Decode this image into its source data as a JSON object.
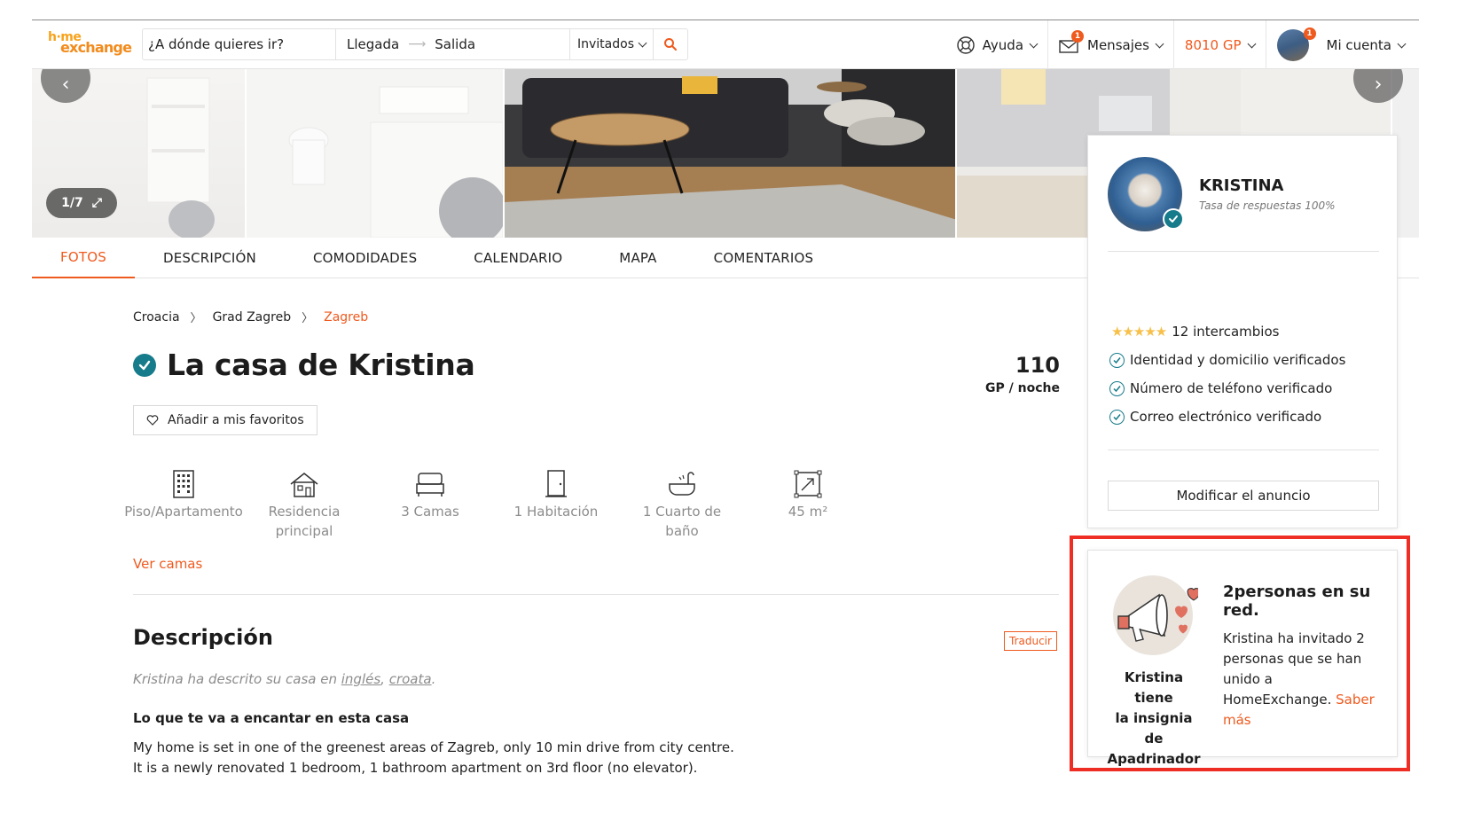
{
  "header": {
    "logo_line1": "h·me",
    "logo_line2": "exchange",
    "search_placeholder": "¿A dónde quieres ir?",
    "checkin": "Llegada",
    "checkout": "Salida",
    "guests": "Invitados",
    "help": "Ayuda",
    "messages": "Mensajes",
    "messages_badge": "1",
    "gp_balance": "8010 GP",
    "account": "Mi cuenta",
    "account_badge": "1"
  },
  "gallery": {
    "counter": "1/7"
  },
  "tabs": [
    {
      "label": "FOTOS"
    },
    {
      "label": "DESCRIPCIÓN"
    },
    {
      "label": "COMODIDADES"
    },
    {
      "label": "CALENDARIO"
    },
    {
      "label": "MAPA"
    },
    {
      "label": "COMENTARIOS"
    }
  ],
  "breadcrumb": [
    "Croacia",
    "Grad Zagreb",
    "Zagreb"
  ],
  "listing": {
    "title": "La casa de Kristina",
    "price": "110",
    "price_unit": "GP / noche",
    "favorite": "Añadir a mis favoritos",
    "features": [
      {
        "icon": "building-icon",
        "line1": "Piso/Apartamento",
        "line2": ""
      },
      {
        "icon": "house-icon",
        "line1": "Residencia",
        "line2": "principal"
      },
      {
        "icon": "bed-icon",
        "line1": "3 Camas",
        "line2": ""
      },
      {
        "icon": "door-icon",
        "line1": "1 Habitación",
        "line2": ""
      },
      {
        "icon": "bathtub-icon",
        "line1": "1 Cuarto de",
        "line2": "baño"
      },
      {
        "icon": "area-icon",
        "line1": "45 m²",
        "line2": ""
      }
    ],
    "see_beds": "Ver camas"
  },
  "description": {
    "heading": "Descripción",
    "translate": "Traducir",
    "note_prefix": "Kristina ha descrito su casa en ",
    "lang1": "inglés",
    "note_sep": ", ",
    "lang2": "croata",
    "note_suffix": ".",
    "love_heading": "Lo que te va a encantar en esta casa",
    "line1": "My home is set in one of the greenest areas of Zagreb, only 10 min drive from city centre.",
    "line2": "It is a newly renovated 1 bedroom, 1 bathroom apartment on 3rd floor (no elevator)."
  },
  "host": {
    "name": "KRISTINA",
    "response_rate": "Tasa de respuestas 100%",
    "stars": "★★★★★",
    "exchanges": "12 intercambios",
    "checks": [
      "Identidad y domicilio verificados",
      "Número de teléfono verificado",
      "Correo electrónico verificado"
    ],
    "edit_button": "Modificar el anuncio"
  },
  "sponsor": {
    "badge_line1": "Kristina tiene",
    "badge_line2": "la insignia de",
    "badge_line3": "Apadrinador",
    "title": "2personas en su red.",
    "body": "Kristina ha invitado 2 personas que se han unido a HomeExchange.",
    "link": "Saber más"
  },
  "colors": {
    "accent": "#ef5a1e",
    "verified": "#167b8a",
    "highlight": "#ee2e24"
  }
}
